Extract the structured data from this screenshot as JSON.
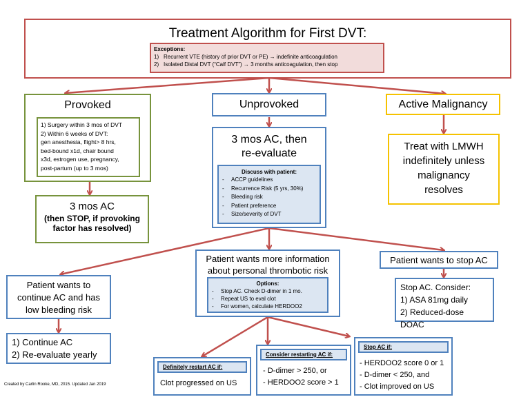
{
  "title": "Treatment Algorithm for First DVT:",
  "exceptions": {
    "heading": "Exceptions:",
    "items": [
      {
        "num": "1)",
        "text": "Recurrent VTE (history of prior DVT or PE) → indefinite anticoagulation"
      },
      {
        "num": "2)",
        "text": "Isolated Distal DVT (“Calf DVT”) → 3 months anticoagulation, then stop"
      }
    ]
  },
  "provoked": {
    "label": "Provoked",
    "criteria": [
      "1) Surgery within 3 mos of DVT",
      "2) Within 6 weeks of DVT:",
      "gen anesthesia, flight> 8 hrs,",
      "bed-bound x1d, chair bound",
      "x3d, estrogen use, pregnancy,",
      "post-partum (up to 3 mos)"
    ],
    "result_title": "3 mos AC",
    "result_note_1": "(then STOP, if provoking",
    "result_note_2": "factor has resolved)"
  },
  "unprovoked": {
    "label": "Unprovoked",
    "plan_1": "3 mos AC, then",
    "plan_2": "re-evaluate",
    "discuss_heading": "Discuss  with patient:",
    "discuss_items": [
      "ACCP guidelines",
      "Recurrence Risk (5 yrs, 30%)",
      "Bleeding risk",
      "Patient preference",
      "Size/severity of DVT"
    ]
  },
  "malignancy": {
    "label": "Active Malignancy",
    "plan": [
      "Treat with LMWH",
      "indefinitely unless",
      "malignancy",
      "resolves"
    ]
  },
  "continue": {
    "label": [
      "Patient wants to",
      "continue AC and has",
      "low bleeding risk"
    ],
    "actions": [
      "1) Continue AC",
      "2) Re-evaluate yearly"
    ]
  },
  "more_info": {
    "label": [
      "Patient wants more information",
      "about personal thrombotic risk"
    ],
    "options_heading": "Options:",
    "options": [
      "Stop AC. Check D-dimer in 1 mo.",
      "Repeat US to eval clot",
      "For women,  calculate HERDOO2"
    ]
  },
  "stop": {
    "label": "Patient wants to stop AC",
    "advice": [
      "Stop AC. Consider:",
      "1) ASA 81mg daily",
      "2) Reduced-dose  DOAC"
    ]
  },
  "restart": {
    "heading": "Definitely restart AC if:",
    "items": [
      "Clot progressed on US"
    ]
  },
  "consider": {
    "heading": "Consider restarting AC if:",
    "items": [
      "- D-dimer  > 250, or",
      "- HERDOO2  score > 1"
    ]
  },
  "stop_if": {
    "heading": "Stop AC if:",
    "items": [
      "- HERDOO2  score 0 or 1",
      "- D-dimer  < 250, and",
      "- Clot improved on US"
    ]
  },
  "footer": "Created  by Carlin Rooke, MD, 2015. Updated Jan 2019",
  "colors": {
    "red": "#c0504d",
    "green": "#77933c",
    "blue": "#4f81bd",
    "gold": "#f5c200",
    "pink_fill": "#f2dcdb",
    "blue_fill": "#dce6f2"
  }
}
